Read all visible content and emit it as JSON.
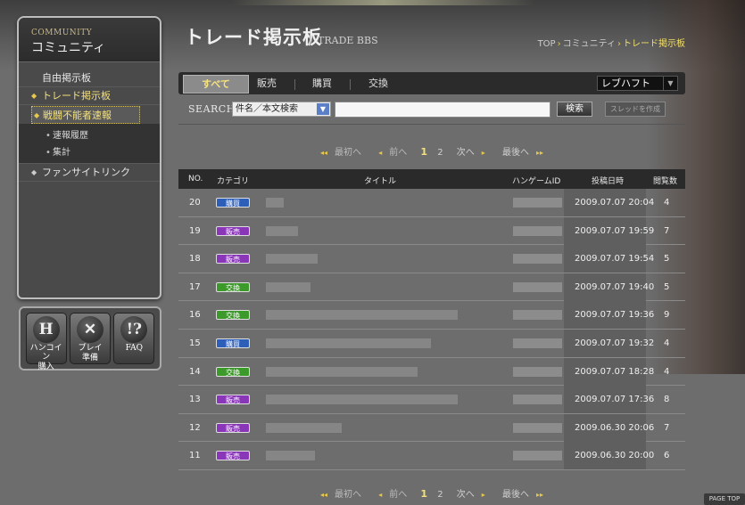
{
  "sidebar": {
    "title_en": "COMMUNITY",
    "title_jp": "コミュニティ",
    "items": [
      {
        "label": "自由掲示板"
      },
      {
        "label": "トレード掲示板"
      },
      {
        "label": "戦闘不能者速報"
      },
      {
        "label": "ファンサイトリンク"
      }
    ],
    "subitems": [
      {
        "label": "速報履歴"
      },
      {
        "label": "集計"
      }
    ]
  },
  "iconbuttons": [
    {
      "glyph": "H",
      "label1": "ハンコイン",
      "label2": "購入",
      "icon": "hancoin-icon"
    },
    {
      "glyph": "✕",
      "label1": "プレイ",
      "label2": "準備",
      "icon": "sword-icon"
    },
    {
      "glyph": "!?",
      "label1": "FAQ",
      "label2": "",
      "icon": "faq-icon"
    }
  ],
  "header": {
    "title": "トレード掲示板",
    "subtitle": "TRADE BBS",
    "breadcrumb": [
      "TOP",
      "コミュニティ",
      "トレード掲示板"
    ]
  },
  "tabs": [
    {
      "label": "すべて"
    },
    {
      "label": "販売"
    },
    {
      "label": "購買"
    },
    {
      "label": "交換"
    }
  ],
  "server_select": {
    "value": "レブハフト"
  },
  "search": {
    "label": "SEARCH",
    "scope": "件名／本文検索",
    "query": "",
    "button": "検索",
    "create_thread": "スレッドを作成"
  },
  "pager": {
    "first": "最初へ",
    "prev": "前へ",
    "pages": [
      "1",
      "2"
    ],
    "current": "1",
    "next": "次へ",
    "last": "最後へ"
  },
  "table": {
    "headers": {
      "no": "NO.",
      "category": "カテゴリ",
      "title": "タイトル",
      "id": "ハンゲームID",
      "date": "投稿日時",
      "views": "閲覧数"
    },
    "rows": [
      {
        "no": "20",
        "category": "購買",
        "date": "2009.07.07 20:04",
        "views": "4"
      },
      {
        "no": "19",
        "category": "販売",
        "date": "2009.07.07 19:59",
        "views": "7"
      },
      {
        "no": "18",
        "category": "販売",
        "date": "2009.07.07 19:54",
        "views": "5"
      },
      {
        "no": "17",
        "category": "交換",
        "date": "2009.07.07 19:40",
        "views": "5"
      },
      {
        "no": "16",
        "category": "交換",
        "date": "2009.07.07 19:36",
        "views": "9"
      },
      {
        "no": "15",
        "category": "購買",
        "date": "2009.07.07 19:32",
        "views": "4"
      },
      {
        "no": "14",
        "category": "交換",
        "date": "2009.07.07 18:28",
        "views": "4"
      },
      {
        "no": "13",
        "category": "販売",
        "date": "2009.07.07 17:36",
        "views": "8"
      },
      {
        "no": "12",
        "category": "販売",
        "date": "2009.06.30 20:06",
        "views": "7"
      },
      {
        "no": "11",
        "category": "販売",
        "date": "2009.06.30 20:00",
        "views": "6"
      }
    ]
  },
  "category_colors": {
    "購買": "#2e5fb8",
    "販売": "#8a36b8",
    "交換": "#3c9a2a"
  },
  "pagetop": "PAGE TOP"
}
